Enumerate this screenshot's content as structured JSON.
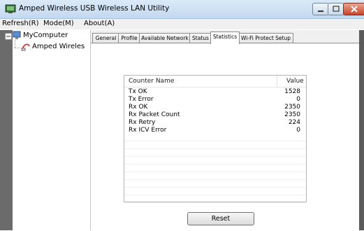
{
  "window": {
    "title": "Amped Wireless USB Wireless LAN Utility"
  },
  "menu": [
    "Refresh(R)",
    "Mode(M)",
    "About(A)"
  ],
  "tree": {
    "root": "MyComputer",
    "child": "Amped Wireles"
  },
  "tabs": [
    "General",
    "Profile",
    "Available Network",
    "Status",
    "Statistics",
    "Wi-Fi Protect Setup"
  ],
  "active_tab": "Statistics",
  "table": {
    "headers": [
      "Counter Name",
      "Value"
    ],
    "rows": [
      {
        "name": "Tx OK",
        "value": "1528"
      },
      {
        "name": "Tx Error",
        "value": "0"
      },
      {
        "name": "Rx OK",
        "value": "2350"
      },
      {
        "name": "Rx Packet Count",
        "value": "2350"
      },
      {
        "name": "Rx Retry",
        "value": "224"
      },
      {
        "name": "Rx ICV Error",
        "value": "0"
      }
    ]
  },
  "buttons": {
    "reset": "Reset"
  }
}
